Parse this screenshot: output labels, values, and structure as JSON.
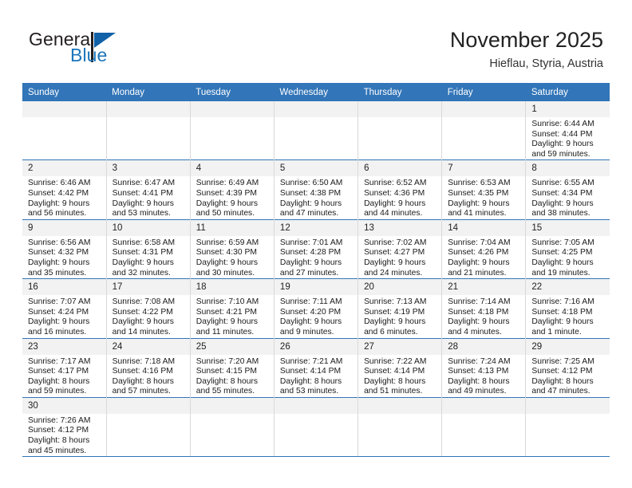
{
  "brand": {
    "name_part1": "General",
    "name_part2": "Blue",
    "triangle_color": "#1161a8",
    "blue_color": "#1b75bb"
  },
  "header": {
    "title": "November 2025",
    "subtitle": "Hieflau, Styria, Austria"
  },
  "theme": {
    "header_row_bg": "#3275b8",
    "daynum_bg": "#f2f2f2",
    "row_divider": "#3275b8",
    "cell_divider": "#d9d9d9"
  },
  "weekdays": [
    "Sunday",
    "Monday",
    "Tuesday",
    "Wednesday",
    "Thursday",
    "Friday",
    "Saturday"
  ],
  "labels": {
    "sunrise_prefix": "Sunrise: ",
    "sunset_prefix": "Sunset: ",
    "daylight_prefix": "Daylight: "
  },
  "weeks": [
    [
      {
        "empty": true
      },
      {
        "empty": true
      },
      {
        "empty": true
      },
      {
        "empty": true
      },
      {
        "empty": true
      },
      {
        "empty": true
      },
      {
        "day": "1",
        "sunrise": "Sunrise: 6:44 AM",
        "sunset": "Sunset: 4:44 PM",
        "daylight_line1": "Daylight: 9 hours",
        "daylight_line2": "and 59 minutes."
      }
    ],
    [
      {
        "day": "2",
        "sunrise": "Sunrise: 6:46 AM",
        "sunset": "Sunset: 4:42 PM",
        "daylight_line1": "Daylight: 9 hours",
        "daylight_line2": "and 56 minutes."
      },
      {
        "day": "3",
        "sunrise": "Sunrise: 6:47 AM",
        "sunset": "Sunset: 4:41 PM",
        "daylight_line1": "Daylight: 9 hours",
        "daylight_line2": "and 53 minutes."
      },
      {
        "day": "4",
        "sunrise": "Sunrise: 6:49 AM",
        "sunset": "Sunset: 4:39 PM",
        "daylight_line1": "Daylight: 9 hours",
        "daylight_line2": "and 50 minutes."
      },
      {
        "day": "5",
        "sunrise": "Sunrise: 6:50 AM",
        "sunset": "Sunset: 4:38 PM",
        "daylight_line1": "Daylight: 9 hours",
        "daylight_line2": "and 47 minutes."
      },
      {
        "day": "6",
        "sunrise": "Sunrise: 6:52 AM",
        "sunset": "Sunset: 4:36 PM",
        "daylight_line1": "Daylight: 9 hours",
        "daylight_line2": "and 44 minutes."
      },
      {
        "day": "7",
        "sunrise": "Sunrise: 6:53 AM",
        "sunset": "Sunset: 4:35 PM",
        "daylight_line1": "Daylight: 9 hours",
        "daylight_line2": "and 41 minutes."
      },
      {
        "day": "8",
        "sunrise": "Sunrise: 6:55 AM",
        "sunset": "Sunset: 4:34 PM",
        "daylight_line1": "Daylight: 9 hours",
        "daylight_line2": "and 38 minutes."
      }
    ],
    [
      {
        "day": "9",
        "sunrise": "Sunrise: 6:56 AM",
        "sunset": "Sunset: 4:32 PM",
        "daylight_line1": "Daylight: 9 hours",
        "daylight_line2": "and 35 minutes."
      },
      {
        "day": "10",
        "sunrise": "Sunrise: 6:58 AM",
        "sunset": "Sunset: 4:31 PM",
        "daylight_line1": "Daylight: 9 hours",
        "daylight_line2": "and 32 minutes."
      },
      {
        "day": "11",
        "sunrise": "Sunrise: 6:59 AM",
        "sunset": "Sunset: 4:30 PM",
        "daylight_line1": "Daylight: 9 hours",
        "daylight_line2": "and 30 minutes."
      },
      {
        "day": "12",
        "sunrise": "Sunrise: 7:01 AM",
        "sunset": "Sunset: 4:28 PM",
        "daylight_line1": "Daylight: 9 hours",
        "daylight_line2": "and 27 minutes."
      },
      {
        "day": "13",
        "sunrise": "Sunrise: 7:02 AM",
        "sunset": "Sunset: 4:27 PM",
        "daylight_line1": "Daylight: 9 hours",
        "daylight_line2": "and 24 minutes."
      },
      {
        "day": "14",
        "sunrise": "Sunrise: 7:04 AM",
        "sunset": "Sunset: 4:26 PM",
        "daylight_line1": "Daylight: 9 hours",
        "daylight_line2": "and 21 minutes."
      },
      {
        "day": "15",
        "sunrise": "Sunrise: 7:05 AM",
        "sunset": "Sunset: 4:25 PM",
        "daylight_line1": "Daylight: 9 hours",
        "daylight_line2": "and 19 minutes."
      }
    ],
    [
      {
        "day": "16",
        "sunrise": "Sunrise: 7:07 AM",
        "sunset": "Sunset: 4:24 PM",
        "daylight_line1": "Daylight: 9 hours",
        "daylight_line2": "and 16 minutes."
      },
      {
        "day": "17",
        "sunrise": "Sunrise: 7:08 AM",
        "sunset": "Sunset: 4:22 PM",
        "daylight_line1": "Daylight: 9 hours",
        "daylight_line2": "and 14 minutes."
      },
      {
        "day": "18",
        "sunrise": "Sunrise: 7:10 AM",
        "sunset": "Sunset: 4:21 PM",
        "daylight_line1": "Daylight: 9 hours",
        "daylight_line2": "and 11 minutes."
      },
      {
        "day": "19",
        "sunrise": "Sunrise: 7:11 AM",
        "sunset": "Sunset: 4:20 PM",
        "daylight_line1": "Daylight: 9 hours",
        "daylight_line2": "and 9 minutes."
      },
      {
        "day": "20",
        "sunrise": "Sunrise: 7:13 AM",
        "sunset": "Sunset: 4:19 PM",
        "daylight_line1": "Daylight: 9 hours",
        "daylight_line2": "and 6 minutes."
      },
      {
        "day": "21",
        "sunrise": "Sunrise: 7:14 AM",
        "sunset": "Sunset: 4:18 PM",
        "daylight_line1": "Daylight: 9 hours",
        "daylight_line2": "and 4 minutes."
      },
      {
        "day": "22",
        "sunrise": "Sunrise: 7:16 AM",
        "sunset": "Sunset: 4:18 PM",
        "daylight_line1": "Daylight: 9 hours",
        "daylight_line2": "and 1 minute."
      }
    ],
    [
      {
        "day": "23",
        "sunrise": "Sunrise: 7:17 AM",
        "sunset": "Sunset: 4:17 PM",
        "daylight_line1": "Daylight: 8 hours",
        "daylight_line2": "and 59 minutes."
      },
      {
        "day": "24",
        "sunrise": "Sunrise: 7:18 AM",
        "sunset": "Sunset: 4:16 PM",
        "daylight_line1": "Daylight: 8 hours",
        "daylight_line2": "and 57 minutes."
      },
      {
        "day": "25",
        "sunrise": "Sunrise: 7:20 AM",
        "sunset": "Sunset: 4:15 PM",
        "daylight_line1": "Daylight: 8 hours",
        "daylight_line2": "and 55 minutes."
      },
      {
        "day": "26",
        "sunrise": "Sunrise: 7:21 AM",
        "sunset": "Sunset: 4:14 PM",
        "daylight_line1": "Daylight: 8 hours",
        "daylight_line2": "and 53 minutes."
      },
      {
        "day": "27",
        "sunrise": "Sunrise: 7:22 AM",
        "sunset": "Sunset: 4:14 PM",
        "daylight_line1": "Daylight: 8 hours",
        "daylight_line2": "and 51 minutes."
      },
      {
        "day": "28",
        "sunrise": "Sunrise: 7:24 AM",
        "sunset": "Sunset: 4:13 PM",
        "daylight_line1": "Daylight: 8 hours",
        "daylight_line2": "and 49 minutes."
      },
      {
        "day": "29",
        "sunrise": "Sunrise: 7:25 AM",
        "sunset": "Sunset: 4:12 PM",
        "daylight_line1": "Daylight: 8 hours",
        "daylight_line2": "and 47 minutes."
      }
    ],
    [
      {
        "day": "30",
        "sunrise": "Sunrise: 7:26 AM",
        "sunset": "Sunset: 4:12 PM",
        "daylight_line1": "Daylight: 8 hours",
        "daylight_line2": "and 45 minutes."
      },
      {
        "empty": true
      },
      {
        "empty": true
      },
      {
        "empty": true
      },
      {
        "empty": true
      },
      {
        "empty": true
      },
      {
        "empty": true
      }
    ]
  ]
}
